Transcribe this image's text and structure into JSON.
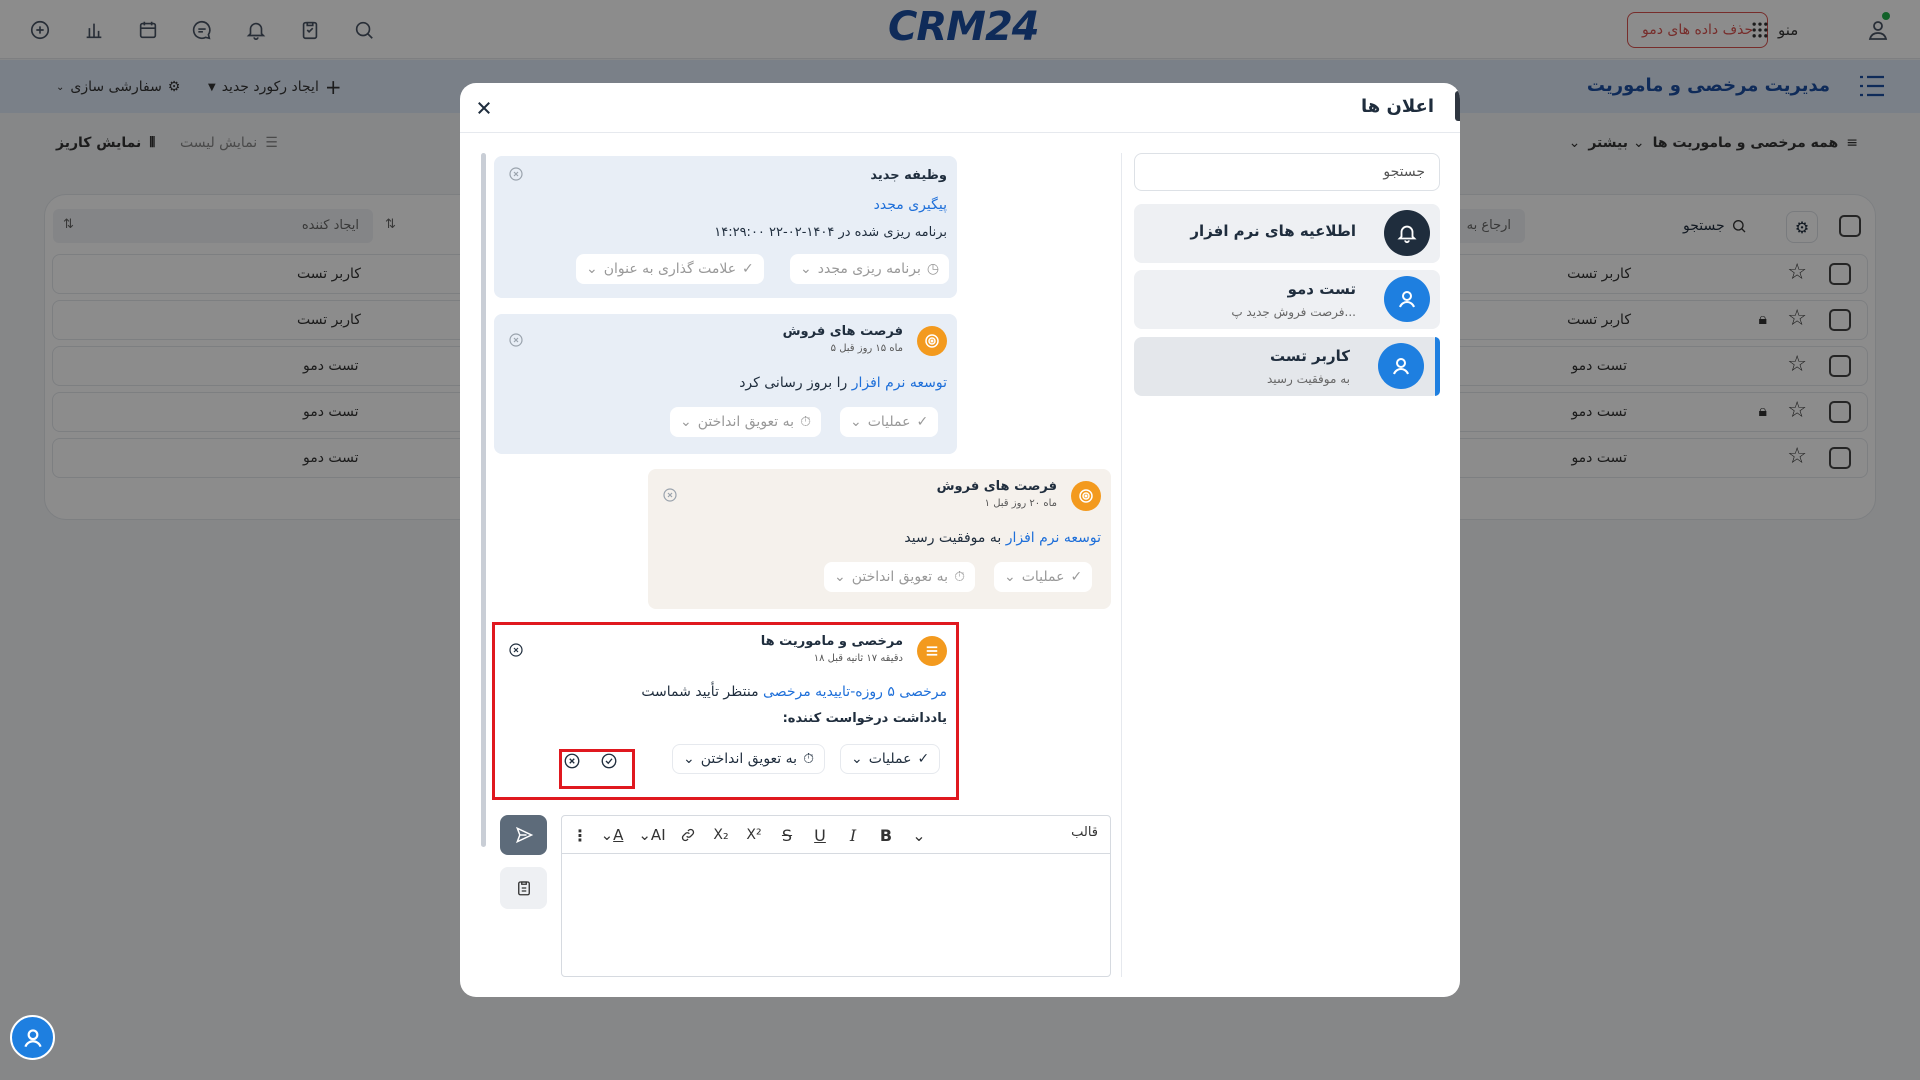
{
  "app": {
    "logo": "CRM24",
    "delete_demo": "حذف داده های دمو",
    "menu_label": "منو",
    "module_title": "مدیریت مرخصی و ماموریت",
    "new_record": "ایجاد رکورد جدید",
    "customize": "سفارشی سازی",
    "filter_all": "همه مرخصی و ماموریت ها",
    "more": "بیشتر",
    "list_view": "نمایش لیست",
    "kanban_view": "نمایش کاریز",
    "search": "جستجو",
    "refer_to": "ارجاع به",
    "created_by": "ایجاد کننده",
    "rows": [
      {
        "left": "کاربر تست",
        "right": "کاربر تست",
        "locked": false
      },
      {
        "left": "کاربر تست",
        "right": "کاربر تست",
        "locked": true
      },
      {
        "left": "تست دمو",
        "right": "تست دمو",
        "locked": false
      },
      {
        "left": "تست دمو",
        "right": "تست دمو",
        "locked": true
      },
      {
        "left": "تست دمو",
        "right": "تست دمو",
        "locked": false
      }
    ]
  },
  "modal": {
    "title": "اعلان ها",
    "search_placeholder": "جستجو",
    "channels": [
      {
        "name": "اطلاعیه های نرم افزار",
        "sub": ""
      },
      {
        "name": "تست دمو",
        "sub": "فرصت فروش جدید پ..."
      },
      {
        "name": "کاربر تست",
        "sub": "به موفقیت رسید"
      }
    ],
    "messages": {
      "m1": {
        "title": "وظیفه جدید",
        "link": "پیگیری مجدد",
        "body": "برنامه ریزی شده در ۱۴۰۴-۰۲-۲۲ ۱۴:۲۹:۰۰",
        "btn1": "برنامه ریزی مجدد",
        "btn2": "علامت گذاری به عنوان"
      },
      "m2": {
        "title": "فرصت های فروش",
        "time": "۵ ماه ۱۵ روز قبل",
        "link": "توسعه نرم افزار",
        "body": "را بروز رسانی کرد",
        "btn1": "عملیات",
        "btn2": "به تعویق انداختن"
      },
      "m3": {
        "title": "فرصت های فروش",
        "time": "۱ ماه ۲۰ روز قبل",
        "link": "توسعه نرم افزار",
        "body": "به موفقیت رسید",
        "btn1": "عملیات",
        "btn2": "به تعویق انداختن"
      },
      "m4": {
        "title": "مرخصی و ماموریت ها",
        "time": "۱۸ دقیقه ۱۷ ثانیه قبل",
        "link": "مرخصی ۵ روزه-تاییدیه مرخصی",
        "body": "منتظر تأیید شماست",
        "note": "یادداشت درخواست کننده:",
        "btn1": "عملیات",
        "btn2": "به تعویق انداختن"
      }
    },
    "editor": {
      "template": "قالب"
    }
  },
  "colors": {
    "brand": "#1d4fa3",
    "accent_blue": "#1e7fe0",
    "orange": "#f39a1e",
    "highlight_red": "#e0181f"
  }
}
